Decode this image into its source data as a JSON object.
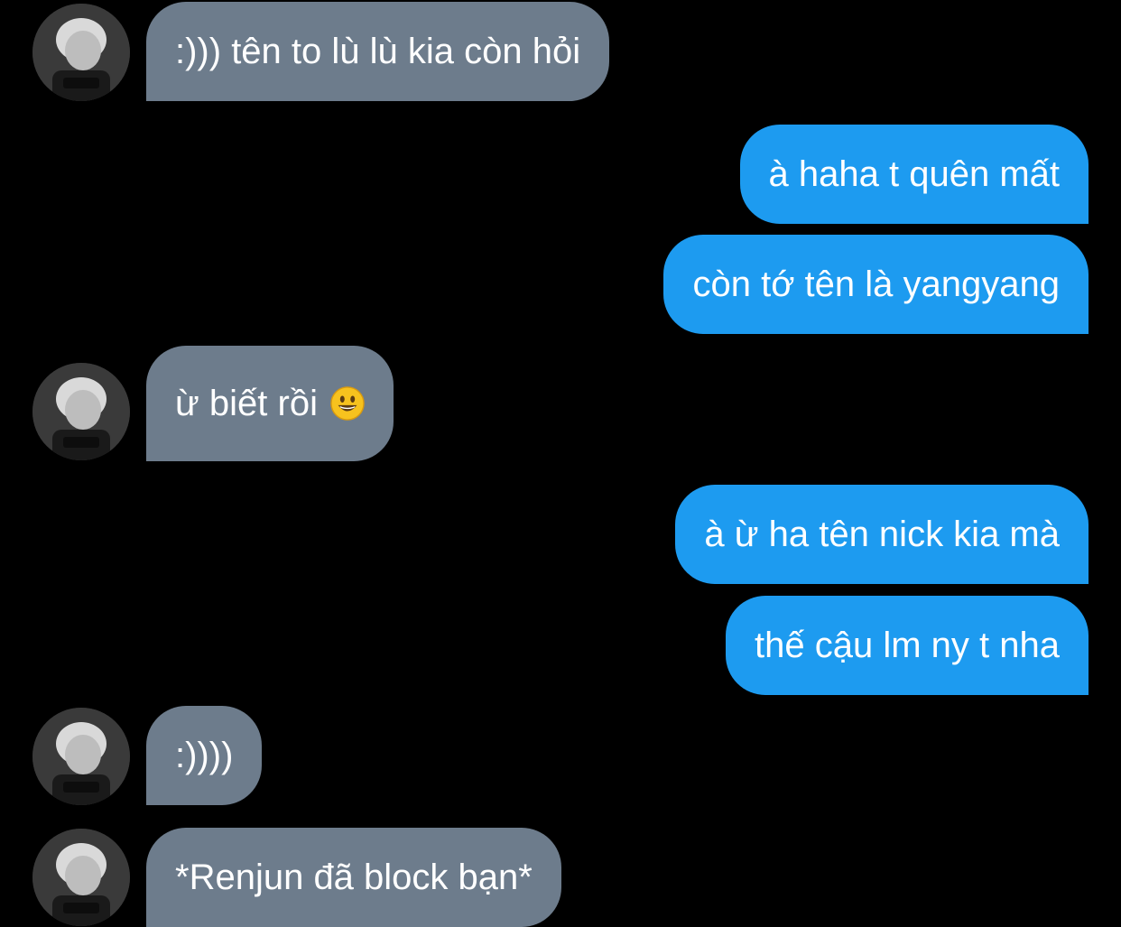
{
  "conversation": {
    "messages": [
      {
        "sender": "contact",
        "text": ":))) tên to lù lù kia còn hỏi"
      },
      {
        "sender": "me",
        "text": "à haha t quên mất"
      },
      {
        "sender": "me",
        "text": "còn tớ tên là yangyang"
      },
      {
        "sender": "contact",
        "text": "ừ biết rồi",
        "emoji": "grinning-face-emoji"
      },
      {
        "sender": "me",
        "text": "à ừ ha tên nick kia mà"
      },
      {
        "sender": "me",
        "text": "thế cậu lm ny t nha"
      },
      {
        "sender": "contact",
        "text": ":))))"
      },
      {
        "sender": "contact",
        "text": "*Renjun đã block bạn*"
      }
    ]
  },
  "colors": {
    "background": "#000000",
    "received_bubble": "#6d7c8c",
    "sent_bubble": "#1d9bf0",
    "text": "#ffffff"
  },
  "icons": {
    "avatar": "contact-avatar-photo",
    "emoji": "grinning-face-emoji"
  }
}
